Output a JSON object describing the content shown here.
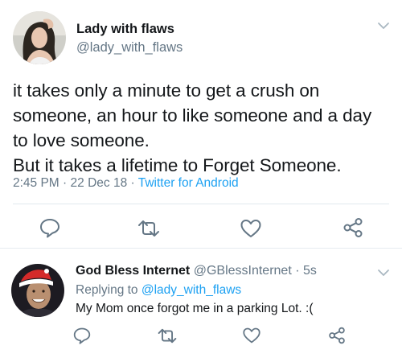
{
  "tweet": {
    "author_name": "Lady with flaws",
    "author_handle": "@lady_with_flaws",
    "text_lines": [
      "it takes only a minute to get a crush on",
      "someone, an hour to like someone and a day",
      "to love someone.",
      "But it takes a lifetime to Forget Someone."
    ],
    "time": "2:45 PM",
    "separator": "·",
    "date": "22 Dec 18",
    "client": "Twitter for Android",
    "actions": [
      "reply-icon",
      "retweet-icon",
      "like-icon",
      "share-icon"
    ],
    "menu_icon": "chevron-down-icon"
  },
  "reply": {
    "author_name": "God Bless Internet",
    "author_handle": "@GBlessInternet",
    "separator": "·",
    "age": "5s",
    "replying_prefix": "Replying to",
    "replying_mention": "@lady_with_flaws",
    "text": "My Mom once forgot me in a parking Lot. :(",
    "actions": [
      "reply-icon",
      "retweet-icon",
      "like-icon",
      "share-icon"
    ],
    "menu_icon": "chevron-down-icon"
  },
  "colors": {
    "link": "#1da1f2",
    "secondary_text": "#657786",
    "icon": "#657786",
    "divider": "#e1e8ed"
  }
}
